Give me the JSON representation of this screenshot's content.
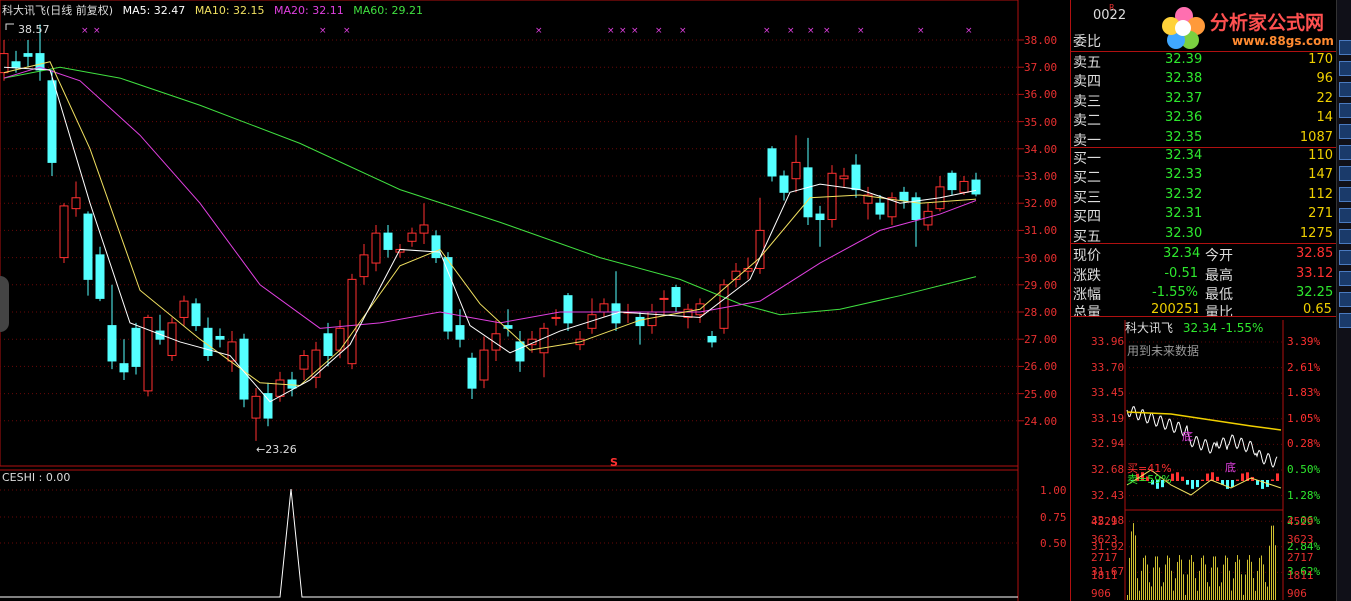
{
  "legend": {
    "title": "科大讯飞(日线 前复权)",
    "ma5": "MA5: 32.47",
    "ma10": "MA10: 32.15",
    "ma20": "MA20: 32.11",
    "ma60": "MA60: 29.21",
    "colors": {
      "title": "#dddddd",
      "ma5": "#ffffff",
      "ma10": "#f0e060",
      "ma20": "#e040e0",
      "ma60": "#40e040"
    }
  },
  "annotations": {
    "high": "38.57",
    "low": "←23.26",
    "signal": "S"
  },
  "indicator": {
    "label": "CESHI : 0.00",
    "ticks": [
      "1.00",
      "0.75",
      "0.50"
    ]
  },
  "price_axis": [
    "38.00",
    "37.00",
    "36.00",
    "35.00",
    "34.00",
    "33.00",
    "32.00",
    "31.00",
    "30.00",
    "29.00",
    "28.00",
    "27.00",
    "26.00",
    "25.00",
    "24.00"
  ],
  "panel": {
    "code": "0022",
    "weibi": "委比",
    "asks": [
      {
        "label": "卖五",
        "price": "32.39",
        "vol": "170"
      },
      {
        "label": "卖四",
        "price": "32.38",
        "vol": "96"
      },
      {
        "label": "卖三",
        "price": "32.37",
        "vol": "22"
      },
      {
        "label": "卖二",
        "price": "32.36",
        "vol": "14"
      },
      {
        "label": "卖一",
        "price": "32.35",
        "vol": "1087"
      }
    ],
    "bids": [
      {
        "label": "买一",
        "price": "32.34",
        "vol": "110"
      },
      {
        "label": "买二",
        "price": "32.33",
        "vol": "147"
      },
      {
        "label": "买三",
        "price": "32.32",
        "vol": "112"
      },
      {
        "label": "买四",
        "price": "32.31",
        "vol": "271"
      },
      {
        "label": "买五",
        "price": "32.30",
        "vol": "1275"
      }
    ],
    "stats": {
      "xianjia_label": "现价",
      "xianjia": "32.34",
      "jinkai_label": "今开",
      "jinkai": "32.85",
      "zhangdie_label": "涨跌",
      "zhangdie": "-0.51",
      "zuigao_label": "最高",
      "zuigao": "33.12",
      "zhangfu_label": "涨幅",
      "zhangfu": "-1.55%",
      "zuidi_label": "最低",
      "zuidi": "32.25",
      "zongliang_label": "总量",
      "zongliang": "200251",
      "liangbi_label": "量比",
      "liangbi": "0.65"
    },
    "mini": {
      "name": "科大讯飞",
      "price": "32.34 -1.55%",
      "future_btn": "用到未来数据",
      "left_ticks": [
        "33.96",
        "33.70",
        "33.45",
        "33.19",
        "32.94",
        "32.68",
        "32.43",
        "32.18",
        "31.92",
        "31.67"
      ],
      "right_ticks": [
        "3.39%",
        "2.61%",
        "1.83%",
        "1.05%",
        "0.28%",
        "0.50%",
        "1.28%",
        "2.06%",
        "2.84%",
        "3.62%"
      ],
      "vol_ticks": [
        "4529",
        "3623",
        "2717",
        "1811",
        "906"
      ],
      "mark_di1": "底",
      "mark_di2": "底",
      "buy_text": "买=41%",
      "sell_text": "卖=59%"
    },
    "logo": "分析家公式网",
    "logo_url": "www.88gs.com"
  }
}
